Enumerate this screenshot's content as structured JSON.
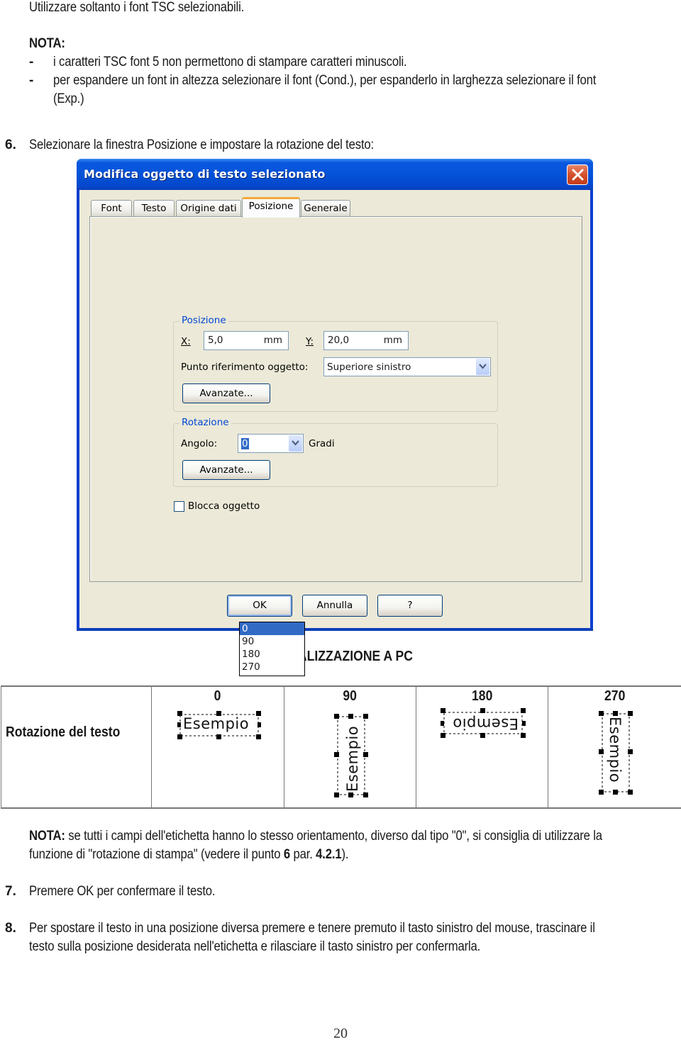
{
  "intro": {
    "line1": "Utilizzare soltanto i font TSC selezionabili.",
    "nota_heading": "NOTA:",
    "bullets": [
      {
        "marker": "-",
        "text": "i caratteri TSC font 5 non permettono di stampare caratteri minuscoli."
      },
      {
        "marker": "-",
        "text": "per espandere un font in altezza selezionare il font (Cond.), per espanderlo in larghezza selezionare il font",
        "text2": "(Exp.)"
      }
    ]
  },
  "step6": {
    "number": "6.",
    "text": "Selezionare la finestra Posizione e impostare la rotazione del testo:"
  },
  "dialog": {
    "title": "Modifica oggetto di testo selezionato",
    "close_icon": "close-x-icon",
    "tabs": [
      {
        "label": "Font",
        "active": false
      },
      {
        "label": "Testo",
        "active": false
      },
      {
        "label": "Origine dati",
        "active": false
      },
      {
        "label": "Posizione",
        "active": true
      },
      {
        "label": "Generale",
        "active": false
      }
    ],
    "posizione_group": {
      "label": "Posizione",
      "x_label": "X:",
      "x_value": "5,0",
      "x_unit": "mm",
      "y_label": "Y:",
      "y_value": "20,0",
      "y_unit": "mm",
      "ref_label": "Punto riferimento oggetto:",
      "ref_value": "Superiore sinistro",
      "advanced_button": "Avanzate..."
    },
    "rotazione_group": {
      "label": "Rotazione",
      "angle_label": "Angolo:",
      "angle_value": "0",
      "unit_label": "Gradi",
      "advanced_button": "Avanzate...",
      "options": [
        "0",
        "90",
        "180",
        "270"
      ],
      "selected_option": "0"
    },
    "lock_checkbox": {
      "label": "Blocca oggetto",
      "checked": false
    },
    "buttons": {
      "ok": "OK",
      "cancel": "Annulla",
      "help": "?"
    },
    "colors": {
      "title_bar": "#0453d8",
      "face": "#ece9d8",
      "group_label": "#0046d5",
      "selection": "#316ac5",
      "active_tab_accent": "#f2a93b"
    }
  },
  "visualization": {
    "title": "VISUALIZZAZIONE A PC",
    "row_header": "Rotazione del testo",
    "sample_text": "Esempio",
    "angles": [
      "0",
      "90",
      "180",
      "270"
    ]
  },
  "note2": {
    "heading": "NOTA:",
    "line1": " se tutti i campi dell'etichetta hanno lo stesso orientamento, diverso dal tipo \"0\", si consiglia di utilizzare la",
    "line2_a": "funzione di \"rotazione di stampa\" (vedere il punto ",
    "line2_b": "6",
    "line2_c": " par. ",
    "line2_d": "4.2.1",
    "line2_e": ")."
  },
  "step7": {
    "number": "7.",
    "text": "Premere OK per confermare il testo."
  },
  "step8": {
    "number": "8.",
    "line1": "Per spostare il testo in una posizione diversa premere e tenere premuto il tasto sinistro del mouse, trascinare il",
    "line2": "testo sulla posizione desiderata nell'etichetta e rilasciare il tasto sinistro per confermarla."
  },
  "page_number": "20"
}
